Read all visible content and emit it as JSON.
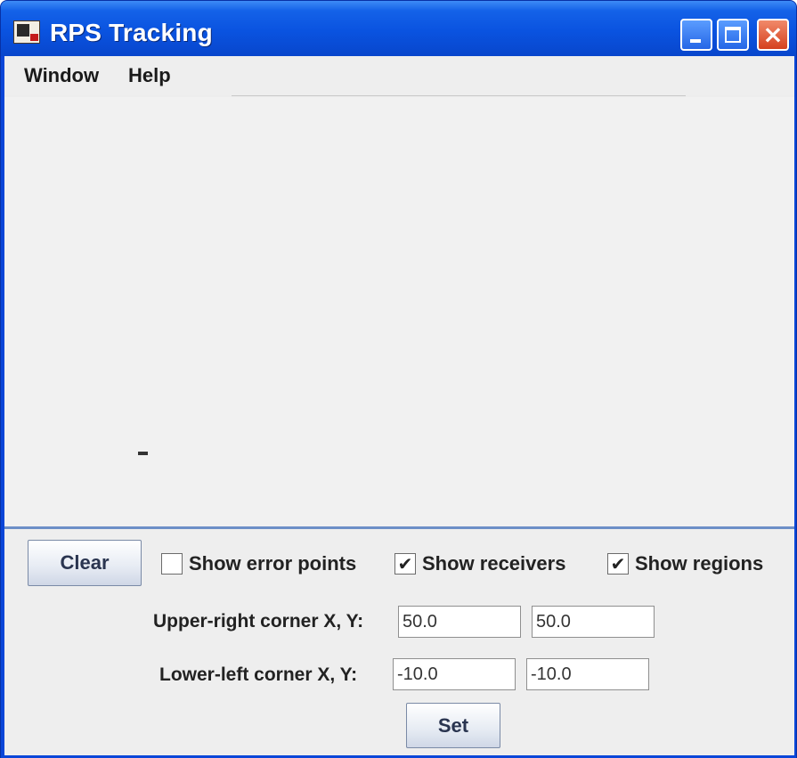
{
  "window": {
    "title": "RPS Tracking",
    "icons": {
      "app": "train-app-icon",
      "minimize": "minimize-icon",
      "maximize": "maximize-icon",
      "close": "close-icon"
    },
    "colors": {
      "titlebar": "#0a53e0",
      "close_button": "#d5411e",
      "client_bg": "#ededed",
      "divider": "#6d8fc8"
    }
  },
  "menubar": {
    "items": [
      {
        "label": "Window"
      },
      {
        "label": "Help"
      }
    ]
  },
  "controls": {
    "clear_label": "Clear",
    "show_error_points": {
      "label": "Show error points",
      "checked": false
    },
    "show_receivers": {
      "label": "Show receivers",
      "checked": true
    },
    "show_regions": {
      "label": "Show regions",
      "checked": true
    },
    "check_mark": "✔",
    "upper_right_label": "Upper-right corner X, Y:",
    "upper_right_x": "50.0",
    "upper_right_y": "50.0",
    "lower_left_label": "Lower-left corner X, Y:",
    "lower_left_x": "-10.0",
    "lower_left_y": "-10.0",
    "set_label": "Set"
  }
}
